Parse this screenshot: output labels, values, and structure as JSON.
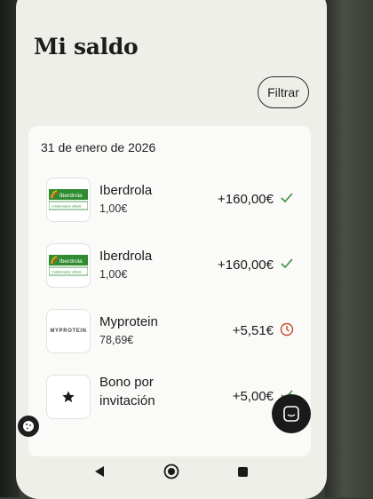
{
  "header": {
    "title": "Mi saldo",
    "filter_label": "Filtrar"
  },
  "section": {
    "date": "31 de enero de 2026"
  },
  "transactions": [
    {
      "merchant": "Iberdrola",
      "purchase": "1,00€",
      "cashback": "+160,00€",
      "status": "confirmed",
      "logo": "iberdrola-logo",
      "logo_text": "Iberdrola",
      "logo_sub": "Colaborador oficial"
    },
    {
      "merchant": "Iberdrola",
      "purchase": "1,00€",
      "cashback": "+160,00€",
      "status": "confirmed",
      "logo": "iberdrola-logo",
      "logo_text": "Iberdrola",
      "logo_sub": "Colaborador oficial"
    },
    {
      "merchant": "Myprotein",
      "purchase": "78,69€",
      "cashback": "+5,51€",
      "status": "pending",
      "logo": "myprotein-logo",
      "logo_text": "MYPROTEIN"
    },
    {
      "merchant_line1": "Bono por",
      "merchant_line2": "invitación",
      "cashback": "+5,00€",
      "status": "confirmed",
      "logo": "star-icon"
    }
  ],
  "colors": {
    "confirmed": "#3d8b40",
    "pending": "#c44a2c",
    "iberdrola_green": "#2f8b2f"
  },
  "icons": {
    "chat": "chat-bubble-icon",
    "cookie": "cookie-icon",
    "back": "back-triangle-icon",
    "home": "home-circle-icon",
    "recents": "recents-square-icon"
  }
}
